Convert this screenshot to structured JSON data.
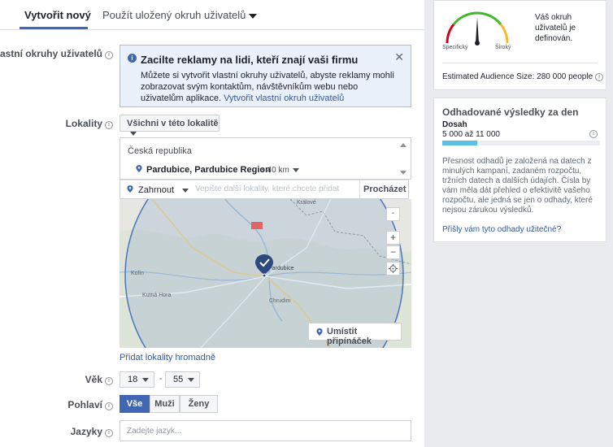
{
  "tabs": {
    "create_new": "Vytvořit nový",
    "use_saved": "Použít uložený okruh uživatelů"
  },
  "labels": {
    "custom_audiences": "Vlastní okruhy uživatelů",
    "locations": "Lokality",
    "age": "Věk",
    "gender": "Pohlaví",
    "languages": "Jazyky"
  },
  "notice": {
    "title": "Zacilte reklamy na lidi, kteří znají vaši firmu",
    "body": "Můžete si vytvořit vlastní okruhy uživatelů, abyste reklamy mohli zobrazovat svým kontaktům, návštěvníkům webu nebo uživatelům aplikace.",
    "link": "Vytvořit vlastní okruh uživatelů",
    "close": "✕"
  },
  "location": {
    "scope_dropdown": "Všichni v této lokalitě",
    "country": "Česká republika",
    "selected_place": "Pardubice, Pardubice Region",
    "radius": "+ 40 km",
    "include_label": "Zahrnout",
    "search_placeholder": "Vepište další lokality, které chcete přidat",
    "browse": "Procházet",
    "place_pin": "Umístit připínáček",
    "bulk_add": "Přidat lokality hromadně"
  },
  "map": {
    "labels": [
      "Králové",
      "Pardubice",
      "Chrudim",
      "Kolín",
      "Kutná Hora"
    ],
    "zoom_in": "+",
    "zoom_out": "−",
    "collapse": "-"
  },
  "age": {
    "min": "18",
    "max": "55",
    "separator": "-"
  },
  "gender": {
    "options": [
      "Vše",
      "Muži",
      "Ženy"
    ],
    "selected": "Vše"
  },
  "languages": {
    "placeholder": "Zadejte jazyk..."
  },
  "audience_meter": {
    "specific": "Specifický",
    "broad": "Široký",
    "status": "Váš okruh uživatelů je definován.",
    "size": "Estimated Audience Size: 280 000 people"
  },
  "estimates": {
    "title": "Odhadované výsledky za den",
    "metric": "Dosah",
    "range": "5 000 až 11 000",
    "bar_fill_fraction": 0.22,
    "note": "Přesnost odhadů je založená na datech z minulých kampaní, zadaném rozpočtu, tržních datech a dalších údajích. Čísla by vám měla dát přehled o efektivitě vašeho rozpočtu, ale jedná se jen o odhady, které nejsou zárukou výsledků.",
    "helpful": "Přišly vám tyto odhady užitečné?"
  },
  "colors": {
    "brand_blue": "#4267b2",
    "link": "#365899",
    "reach_bar": "#5bc0e3",
    "gauge_red": "#d0021b",
    "gauge_green": "#42b72a",
    "gauge_orange": "#f7b928"
  }
}
